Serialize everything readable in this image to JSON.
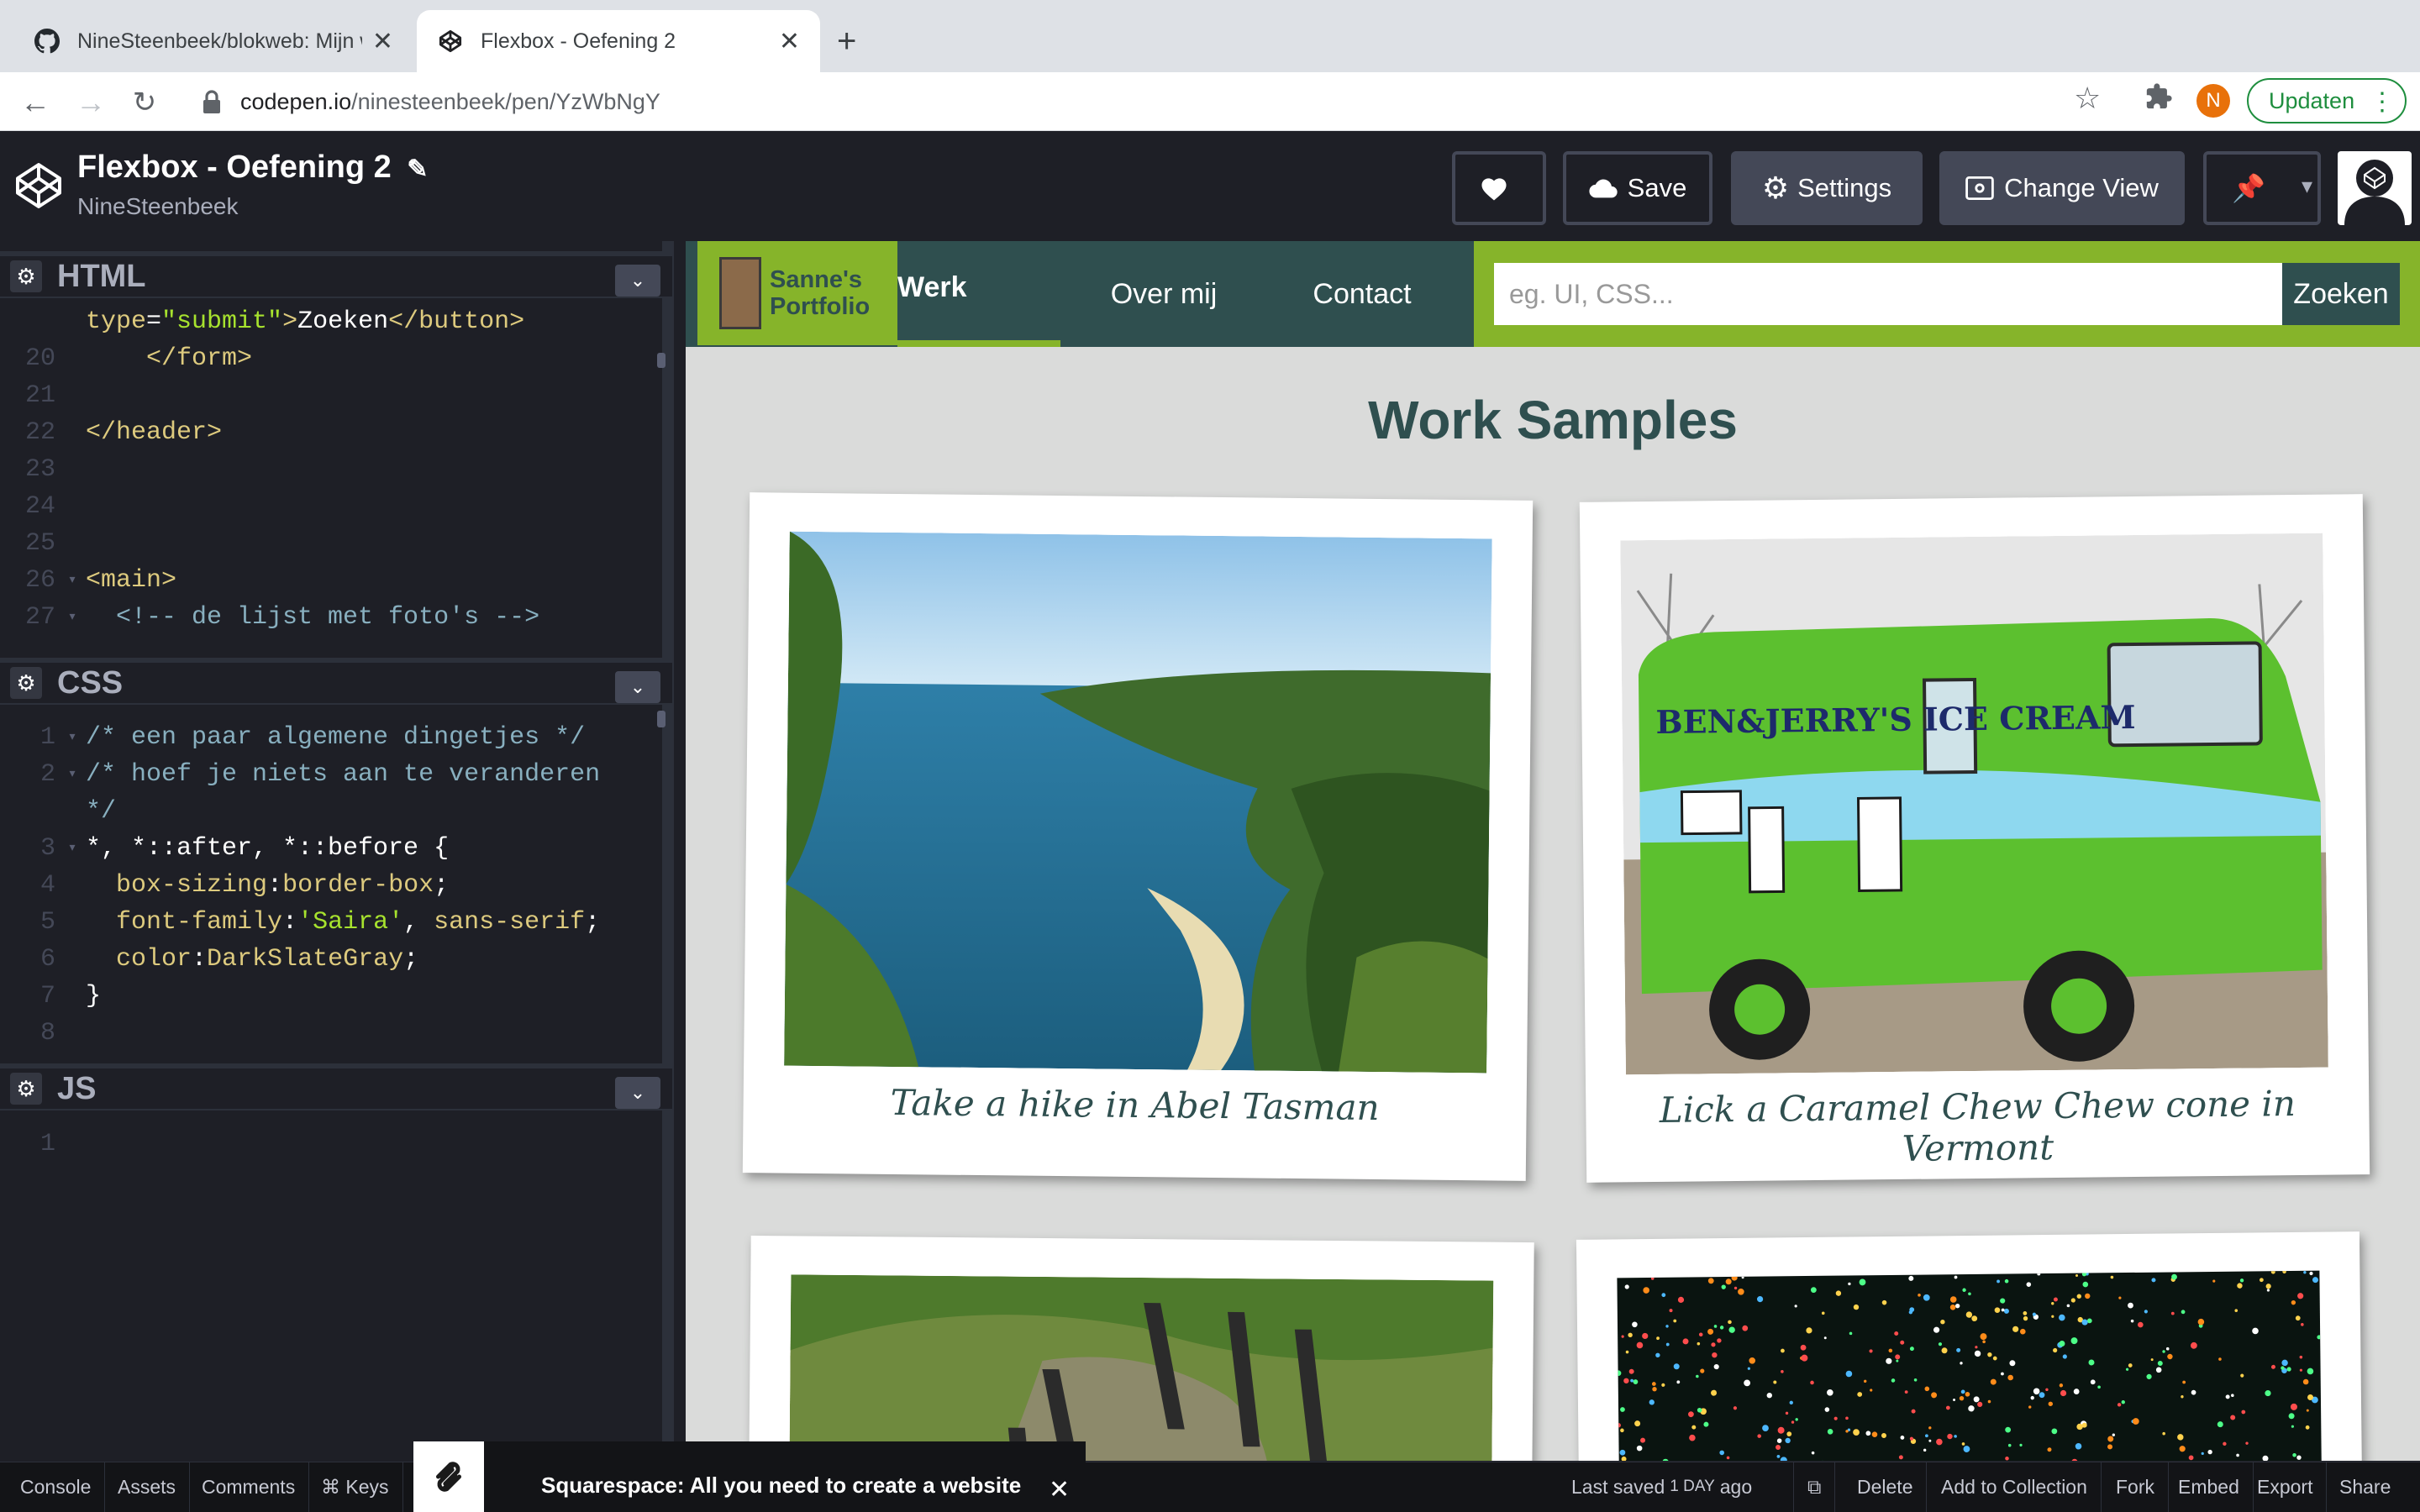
{
  "browser": {
    "tabs": [
      {
        "title": "NineSteenbeek/blokweb: Mijn w",
        "icon": "github-icon"
      },
      {
        "title": "Flexbox - Oefening 2",
        "icon": "codepen-icon"
      }
    ],
    "url_host": "codepen.io",
    "url_path": "/ninesteenbeek/pen/YzWbNgY",
    "profile_initial": "N",
    "update_label": "Updaten"
  },
  "codepen": {
    "pen_title": "Flexbox - Oefening 2",
    "author": "NineSteenbeek",
    "buttons": {
      "save": "Save",
      "settings": "Settings",
      "change_view": "Change View"
    },
    "panes": {
      "html": "HTML",
      "css": "CSS",
      "js": "JS"
    }
  },
  "html_code": {
    "lines": [
      {
        "num": "",
        "fold": "",
        "parts": [
          [
            "c-attr",
            "type"
          ],
          [
            "c-sel",
            "="
          ],
          [
            "c-str",
            "\"submit\""
          ],
          [
            "c-tag",
            ">"
          ],
          [
            "c-sel",
            "Zoeken"
          ],
          [
            "c-tag",
            "</button>"
          ]
        ]
      },
      {
        "num": "20",
        "fold": "",
        "parts": [
          [
            "c-sel",
            "    "
          ],
          [
            "c-tag",
            "</form>"
          ]
        ]
      },
      {
        "num": "21",
        "fold": "",
        "parts": []
      },
      {
        "num": "22",
        "fold": "",
        "parts": [
          [
            "c-tag",
            "</header>"
          ]
        ]
      },
      {
        "num": "23",
        "fold": "",
        "parts": []
      },
      {
        "num": "24",
        "fold": "",
        "parts": []
      },
      {
        "num": "25",
        "fold": "",
        "parts": []
      },
      {
        "num": "26",
        "fold": "▾",
        "parts": [
          [
            "c-tag",
            "<main>"
          ]
        ]
      },
      {
        "num": "27",
        "fold": "▾",
        "parts": [
          [
            "c-cmt",
            "  <!-- de lijst met foto's -->"
          ]
        ]
      }
    ]
  },
  "css_code": {
    "lines": [
      {
        "num": "1",
        "fold": "▾",
        "parts": [
          [
            "c-cmt",
            "/* een paar algemene dingetjes */"
          ]
        ]
      },
      {
        "num": "2",
        "fold": "▾",
        "parts": [
          [
            "c-cmt",
            "/* hoef je niets aan te veranderen"
          ]
        ]
      },
      {
        "num": "",
        "fold": "",
        "parts": [
          [
            "c-cmt",
            "*/"
          ]
        ]
      },
      {
        "num": "3",
        "fold": "▾",
        "parts": [
          [
            "c-sel",
            "*, *::after, *::before {"
          ]
        ]
      },
      {
        "num": "4",
        "fold": "",
        "parts": [
          [
            "c-prop",
            "  box-sizing"
          ],
          [
            "c-sel",
            ":"
          ],
          [
            "c-val",
            "border-box"
          ],
          [
            "c-sel",
            ";"
          ]
        ]
      },
      {
        "num": "5",
        "fold": "",
        "parts": [
          [
            "c-prop",
            "  font-family"
          ],
          [
            "c-sel",
            ":"
          ],
          [
            "c-str",
            "'Saira'"
          ],
          [
            "c-sel",
            ", "
          ],
          [
            "c-val",
            "sans-serif"
          ],
          [
            "c-sel",
            ";"
          ]
        ]
      },
      {
        "num": "6",
        "fold": "",
        "parts": [
          [
            "c-prop",
            "  color"
          ],
          [
            "c-sel",
            ":"
          ],
          [
            "c-val",
            "DarkSlateGray"
          ],
          [
            "c-sel",
            ";"
          ]
        ]
      },
      {
        "num": "7",
        "fold": "",
        "parts": [
          [
            "c-sel",
            "}"
          ]
        ]
      },
      {
        "num": "8",
        "fold": "",
        "parts": []
      }
    ]
  },
  "js_code": {
    "lines": [
      {
        "num": "1",
        "fold": "",
        "parts": []
      }
    ]
  },
  "site": {
    "logo_line1": "Sanne's",
    "logo_line2": "Portfolio",
    "nav": [
      "Werk",
      "Over mij",
      "Contact"
    ],
    "search_placeholder": "eg. UI, CSS...",
    "search_button": "Zoeken",
    "heading": "Work Samples",
    "cards": [
      {
        "caption": "Take a hike in Abel Tasman",
        "photo": "coastal-bay"
      },
      {
        "caption": "Lick a Caramel Chew Chew cone in Vermont",
        "photo": "ice-cream-van"
      },
      {
        "caption": "",
        "photo": "alligators"
      },
      {
        "caption": "",
        "photo": "christmas-lights"
      }
    ],
    "van_text": "BEN&JERRY'S   ICE CREAM"
  },
  "footer": {
    "buttons": [
      "Console",
      "Assets",
      "Comments",
      "⌘ Keys"
    ],
    "ad_text": "Squarespace: All you need to create a website",
    "last_saved_prefix": "Last saved",
    "last_saved_when": "1 DAY",
    "last_saved_suffix": "ago",
    "actions": [
      "Delete",
      "Add to Collection",
      "Fork",
      "Embed",
      "Export",
      "Share"
    ]
  },
  "colors": {
    "accent": "#86b42a",
    "site_dark": "#2f4f4f",
    "editor_bg": "#1e1f26"
  }
}
